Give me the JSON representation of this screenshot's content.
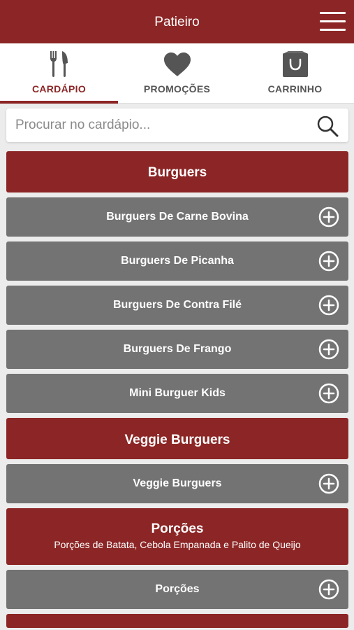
{
  "header": {
    "title": "Patieiro"
  },
  "tabs": [
    {
      "label": "CARDÁPIO",
      "icon": "fork-knife-icon",
      "active": true
    },
    {
      "label": "PROMOÇÕES",
      "icon": "heart-icon",
      "active": false
    },
    {
      "label": "CARRINHO",
      "icon": "shopping-bag-icon",
      "active": false
    }
  ],
  "search": {
    "placeholder": "Procurar no cardápio...",
    "value": ""
  },
  "colors": {
    "brand": "#8c2626",
    "item_bg": "#737373",
    "background": "#ececec"
  },
  "menu": {
    "burgers": {
      "title": "Burguers",
      "items": [
        "Burguers De Carne Bovina",
        "Burguers De Picanha",
        "Burguers De Contra Filé",
        "Burguers De Frango",
        "Mini Burguer Kids"
      ]
    },
    "veggie": {
      "title": "Veggie Burguers",
      "items": [
        "Veggie Burguers"
      ]
    },
    "porcoes": {
      "title": "Porções",
      "subtitle": "Porções de Batata, Cebola Empanada e Palito de Queijo",
      "items": [
        "Porções"
      ]
    }
  }
}
